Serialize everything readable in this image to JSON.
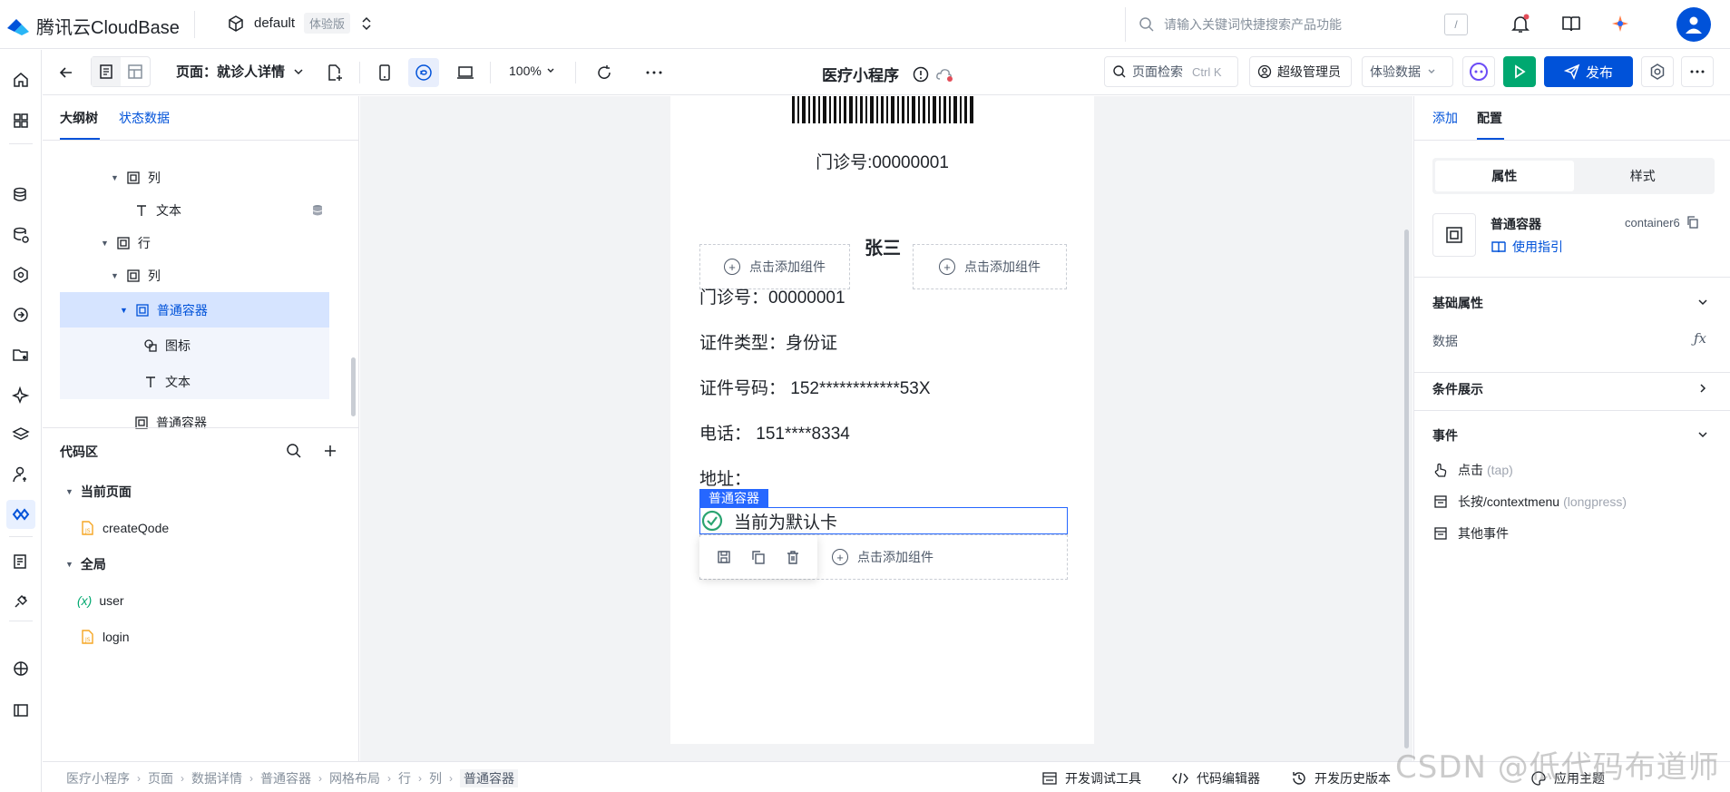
{
  "topbar": {
    "brand": "腾讯云CloudBase",
    "env_name": "default",
    "env_tag": "体验版",
    "search_placeholder": "请输入关键词快捷搜索产品功能",
    "search_shortcut": "/"
  },
  "toolbar": {
    "page_label": "页面：就诊人详情",
    "zoom": "100%",
    "app_title": "医疗小程序",
    "page_search_label": "页面检索",
    "page_search_shortcut": "Ctrl K",
    "role_label": "超级管理员",
    "data_mode_label": "体验数据",
    "publish_label": "发布"
  },
  "left_panel": {
    "tabs": [
      "大纲树",
      "状态数据"
    ],
    "active_tab": 0,
    "tree": [
      {
        "label": "列",
        "type": "container",
        "expanded": true
      },
      {
        "label": "文本",
        "type": "text",
        "has_data_icon": true
      },
      {
        "label": "行",
        "type": "container",
        "expanded": true
      },
      {
        "label": "列",
        "type": "container",
        "expanded": true
      },
      {
        "label": "普通容器",
        "type": "container",
        "expanded": true,
        "selected": true
      },
      {
        "label": "图标",
        "type": "icon"
      },
      {
        "label": "文本",
        "type": "text"
      },
      {
        "label": "普通容器",
        "type": "container"
      }
    ],
    "code_area": {
      "title": "代码区",
      "groups": [
        {
          "label": "当前页面",
          "items": [
            {
              "label": "createQode",
              "kind": "js-file"
            }
          ]
        },
        {
          "label": "全局",
          "items": [
            {
              "label": "user",
              "kind": "variable",
              "prefix": "(x)"
            },
            {
              "label": "login",
              "kind": "js-file"
            }
          ]
        }
      ]
    }
  },
  "canvas": {
    "clinic_number": "门诊号:00000001",
    "name": "张三",
    "add_component": "点击添加组件",
    "details": [
      "门诊号：00000001",
      "证件类型：身份证",
      "证件号码： 152************53X",
      "电话： 151****8334",
      "地址："
    ],
    "selection_tag": "普通容器",
    "default_card": "当前为默认卡"
  },
  "right_panel": {
    "tabs": [
      "添加",
      "配置"
    ],
    "active_tab": 1,
    "subtabs": [
      "属性",
      "样式"
    ],
    "active_subtab": 0,
    "component_name": "普通容器",
    "component_id": "container6",
    "guide_label": "使用指引",
    "sections": {
      "basic": "基础属性",
      "data_label": "数据",
      "condition": "条件展示",
      "events": "事件"
    },
    "events": [
      {
        "label": "点击",
        "sub": "(tap)"
      },
      {
        "label": "长按/contextmenu",
        "sub": "(longpress)"
      },
      {
        "label": "其他事件",
        "sub": ""
      }
    ]
  },
  "bottombar": {
    "breadcrumb": [
      "医疗小程序",
      "页面",
      "数据详情",
      "普通容器",
      "网格布局",
      "行",
      "列",
      "普通容器"
    ],
    "tools": [
      "开发调试工具",
      "代码编辑器",
      "开发历史版本",
      "应用主题"
    ]
  },
  "watermark": "CSDN @低代码布道师",
  "colors": {
    "primary": "#0052d9",
    "run_green": "#00a870",
    "success_green": "#2ba471",
    "selection_blue": "#2667ff"
  }
}
